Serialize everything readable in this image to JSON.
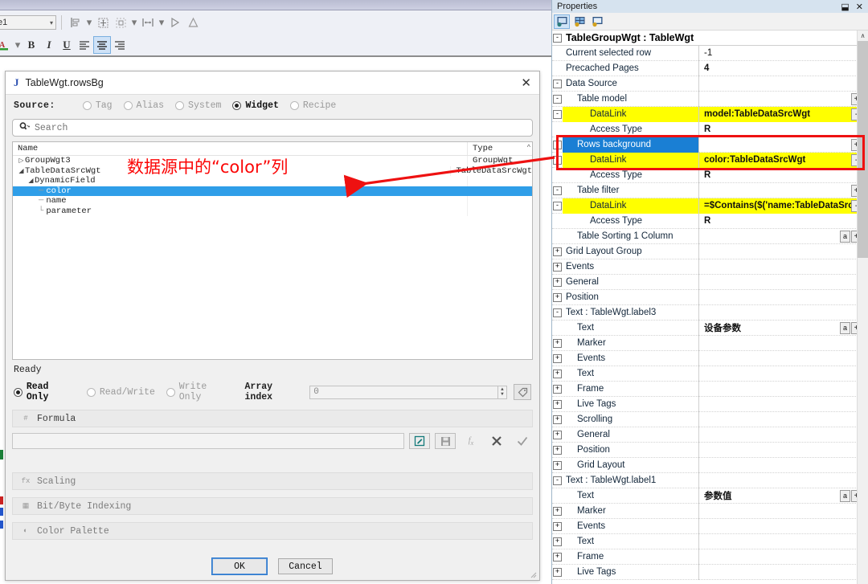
{
  "app": {
    "toolbar": {
      "combo_value": "e1",
      "buttons": [
        {
          "name": "align-left-tool",
          "label": ""
        },
        {
          "name": "align-dropdown",
          "label": "▾"
        },
        {
          "name": "resize-tool",
          "label": ""
        },
        {
          "name": "distribute-tool",
          "label": ""
        },
        {
          "name": "distribute-dropdown",
          "label": "▾"
        },
        {
          "name": "spacing-tool",
          "label": ""
        },
        {
          "name": "spacing-dropdown",
          "label": "▾"
        },
        {
          "name": "flip-horizontal-tool",
          "label": ""
        },
        {
          "name": "flip-vertical-tool",
          "label": ""
        }
      ],
      "font_color_label": "A",
      "font_color_dropdown": "▾",
      "bold_label": "B",
      "italic_label": "I",
      "underline_label": "U"
    }
  },
  "dialog": {
    "title": "TableWgt.rowsBg",
    "icon": "J",
    "close_label": "✕",
    "source_label": "Source:",
    "source_options": [
      {
        "label": "Tag",
        "selected": false
      },
      {
        "label": "Alias",
        "selected": false
      },
      {
        "label": "System",
        "selected": false
      },
      {
        "label": "Widget",
        "selected": true
      },
      {
        "label": "Recipe",
        "selected": false
      }
    ],
    "search_placeholder": "Search",
    "search_value": "",
    "tree": {
      "columns": [
        "Name",
        "Type"
      ],
      "rows": [
        {
          "indent": 1,
          "twisty": "▷",
          "name": "GroupWgt3",
          "type": "GroupWgt",
          "selected": false
        },
        {
          "indent": 1,
          "twisty": "◢",
          "name": "TableDataSrcWgt",
          "type": "TableDataSrcWgt",
          "selected": false
        },
        {
          "indent": 2,
          "twisty": "◢",
          "name": "DynamicField",
          "type": "",
          "selected": false
        },
        {
          "indent": 3,
          "twisty": "",
          "name": "color",
          "type": "",
          "selected": true
        },
        {
          "indent": 3,
          "twisty": "",
          "name": "name",
          "type": "",
          "selected": false
        },
        {
          "indent": 3,
          "twisty": "",
          "name": "parameter",
          "type": "",
          "selected": false
        }
      ]
    },
    "status": "Ready",
    "access_options": [
      {
        "label": "Read Only",
        "selected": true
      },
      {
        "label": "Read/Write",
        "selected": false
      },
      {
        "label": "Write Only",
        "selected": false
      }
    ],
    "array_index_label": "Array index",
    "array_index_value": "0",
    "formula_section": "Formula",
    "formula_value": "",
    "formula_buttons": [
      {
        "name": "edit-formula-button",
        "glyph": "✎"
      },
      {
        "name": "save-formula-button",
        "glyph": "Ὃe"
      },
      {
        "name": "function-button",
        "glyph": "fx"
      },
      {
        "name": "clear-formula-button",
        "glyph": "✕"
      },
      {
        "name": "apply-formula-button",
        "glyph": "✓"
      }
    ],
    "sections": [
      {
        "name": "scaling-section",
        "label": "Scaling",
        "icon": "fx"
      },
      {
        "name": "bit-byte-indexing-section",
        "label": "Bit/Byte Indexing",
        "icon": "▦"
      },
      {
        "name": "color-palette-section",
        "label": "Color Palette",
        "icon": "◐"
      }
    ],
    "ok_label": "OK",
    "cancel_label": "Cancel"
  },
  "properties": {
    "panel_title": "Properties",
    "pin_label": "⬓",
    "close_label": "✕",
    "tools": [
      {
        "name": "properties-view-button",
        "selected": true
      },
      {
        "name": "categorized-view-button",
        "selected": false
      },
      {
        "name": "alphabetical-view-button",
        "selected": false
      }
    ],
    "scroll_up_label": "∧",
    "rows": [
      {
        "type": "header",
        "expander": "-",
        "indent": 0,
        "name": "TableGroupWgt : TableWgt",
        "value": ""
      },
      {
        "type": "row",
        "expander": "",
        "indent": 1,
        "name": "Current selected row",
        "value": "-1"
      },
      {
        "type": "row",
        "expander": "",
        "indent": 1,
        "name": "Precached Pages",
        "value": "4",
        "value_bold": true
      },
      {
        "type": "row",
        "expander": "-",
        "indent": 1,
        "name": "Data Source",
        "value": ""
      },
      {
        "type": "row",
        "expander": "-",
        "indent": 2,
        "name": "Table model",
        "value": "",
        "btn": "+"
      },
      {
        "type": "row",
        "expander": "-",
        "indent": 3,
        "name": "DataLink",
        "value": "model:TableDataSrcWgt",
        "name_hl": "yellow",
        "value_hl": "yellow",
        "btn": "-"
      },
      {
        "type": "row",
        "expander": "",
        "indent": 3,
        "name": "Access Type",
        "value": "R",
        "value_bold": true
      },
      {
        "type": "row",
        "expander": "-",
        "indent": 2,
        "name": "Rows background",
        "value": "",
        "name_hl": "blue",
        "btn": "+"
      },
      {
        "type": "row",
        "expander": "-",
        "indent": 3,
        "name": "DataLink",
        "value": "color:TableDataSrcWgt",
        "name_hl": "yellow",
        "value_hl": "yellow",
        "btn": "-"
      },
      {
        "type": "row",
        "expander": "",
        "indent": 3,
        "name": "Access Type",
        "value": "R",
        "value_bold": true
      },
      {
        "type": "row",
        "expander": "-",
        "indent": 2,
        "name": "Table filter",
        "value": "",
        "btn": "+"
      },
      {
        "type": "row",
        "expander": "-",
        "indent": 3,
        "name": "DataLink",
        "value": "=$Contains($('name:TableDataSrcW",
        "name_hl": "yellow",
        "value_hl": "yellow",
        "btn": "-"
      },
      {
        "type": "row",
        "expander": "",
        "indent": 3,
        "name": "Access Type",
        "value": "R",
        "value_bold": true
      },
      {
        "type": "row",
        "expander": "",
        "indent": 2,
        "name": "Table Sorting 1 Column",
        "value": "",
        "btn": "+",
        "btn2": "a"
      },
      {
        "type": "row",
        "expander": "+",
        "indent": 1,
        "name": "Grid Layout Group",
        "value": ""
      },
      {
        "type": "row",
        "expander": "+",
        "indent": 1,
        "name": "Events",
        "value": ""
      },
      {
        "type": "row",
        "expander": "+",
        "indent": 1,
        "name": "General",
        "value": ""
      },
      {
        "type": "row",
        "expander": "+",
        "indent": 1,
        "name": "Position",
        "value": ""
      },
      {
        "type": "row",
        "expander": "-",
        "indent": 1,
        "name": "Text : TableWgt.label3",
        "value": ""
      },
      {
        "type": "row",
        "expander": "",
        "indent": 2,
        "name": "Text",
        "value": "设备参数",
        "value_bold": true,
        "btn": "+",
        "btn2": "a"
      },
      {
        "type": "row",
        "expander": "+",
        "indent": 2,
        "name": "Marker",
        "value": ""
      },
      {
        "type": "row",
        "expander": "+",
        "indent": 2,
        "name": "Events",
        "value": ""
      },
      {
        "type": "row",
        "expander": "+",
        "indent": 2,
        "name": "Text",
        "value": ""
      },
      {
        "type": "row",
        "expander": "+",
        "indent": 2,
        "name": "Frame",
        "value": ""
      },
      {
        "type": "row",
        "expander": "+",
        "indent": 2,
        "name": "Live Tags",
        "value": ""
      },
      {
        "type": "row",
        "expander": "+",
        "indent": 2,
        "name": "Scrolling",
        "value": ""
      },
      {
        "type": "row",
        "expander": "+",
        "indent": 2,
        "name": "General",
        "value": ""
      },
      {
        "type": "row",
        "expander": "+",
        "indent": 2,
        "name": "Position",
        "value": ""
      },
      {
        "type": "row",
        "expander": "+",
        "indent": 2,
        "name": "Grid Layout",
        "value": ""
      },
      {
        "type": "row",
        "expander": "-",
        "indent": 1,
        "name": "Text : TableWgt.label1",
        "value": ""
      },
      {
        "type": "row",
        "expander": "",
        "indent": 2,
        "name": "Text",
        "value": "参数值",
        "value_bold": true,
        "btn": "+",
        "btn2": "a"
      },
      {
        "type": "row",
        "expander": "+",
        "indent": 2,
        "name": "Marker",
        "value": ""
      },
      {
        "type": "row",
        "expander": "+",
        "indent": 2,
        "name": "Events",
        "value": ""
      },
      {
        "type": "row",
        "expander": "+",
        "indent": 2,
        "name": "Text",
        "value": ""
      },
      {
        "type": "row",
        "expander": "+",
        "indent": 2,
        "name": "Frame",
        "value": ""
      },
      {
        "type": "row",
        "expander": "+",
        "indent": 2,
        "name": "Live Tags",
        "value": ""
      }
    ]
  },
  "annotations": {
    "callout_text": "数据源中的“color”列",
    "callout_color": "#fb0606",
    "highlight_box_color": "#ee1111"
  },
  "colors": {
    "yellow_highlight": "#ffff00",
    "blue_selection": "#1a7fd4",
    "tree_selection": "#2f9ee8",
    "panel_title_bg": "#d6e3ef"
  }
}
